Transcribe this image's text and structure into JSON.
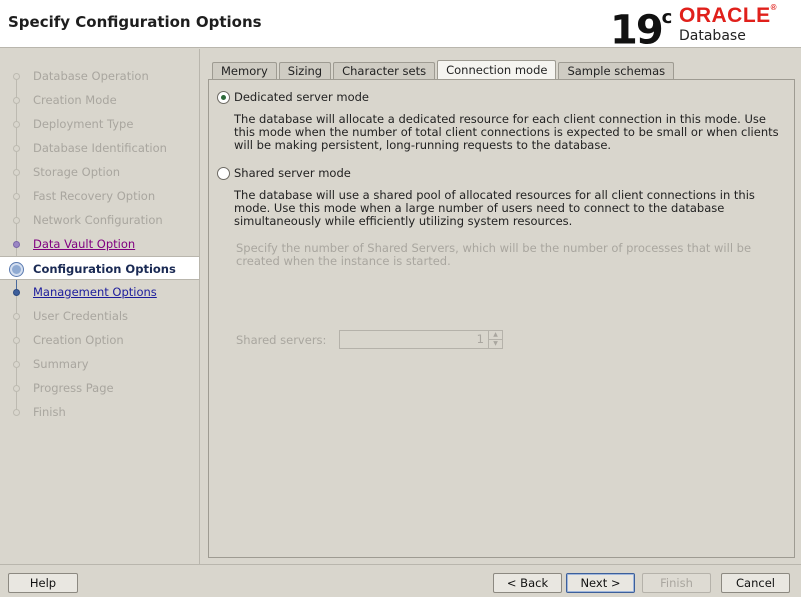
{
  "header": {
    "title": "Specify Configuration Options",
    "logo": {
      "version": "19",
      "version_sup": "c",
      "brand": "ORACLE",
      "brand_mark": "®",
      "product": "Database"
    }
  },
  "sidebar": {
    "steps": [
      {
        "label": "Database Operation",
        "state": "disabled"
      },
      {
        "label": "Creation Mode",
        "state": "disabled"
      },
      {
        "label": "Deployment Type",
        "state": "disabled"
      },
      {
        "label": "Database Identification",
        "state": "disabled"
      },
      {
        "label": "Storage Option",
        "state": "disabled"
      },
      {
        "label": "Fast Recovery Option",
        "state": "disabled"
      },
      {
        "label": "Network Configuration",
        "state": "disabled"
      },
      {
        "label": "Data Vault Option",
        "state": "visited"
      },
      {
        "label": "Configuration Options",
        "state": "current"
      },
      {
        "label": "Management Options",
        "state": "link"
      },
      {
        "label": "User Credentials",
        "state": "disabled"
      },
      {
        "label": "Creation Option",
        "state": "disabled"
      },
      {
        "label": "Summary",
        "state": "disabled"
      },
      {
        "label": "Progress Page",
        "state": "disabled"
      },
      {
        "label": "Finish",
        "state": "disabled"
      }
    ]
  },
  "tabs": [
    {
      "label": "Memory",
      "active": false
    },
    {
      "label": "Sizing",
      "active": false
    },
    {
      "label": "Character sets",
      "active": false
    },
    {
      "label": "Connection mode",
      "active": true
    },
    {
      "label": "Sample schemas",
      "active": false
    }
  ],
  "connection_mode": {
    "dedicated": {
      "label": "Dedicated server mode",
      "selected": true,
      "description": "The database will allocate a dedicated resource for each client connection in this mode. Use this mode when the number of total client connections is expected to be small or when clients will be making persistent, long-running requests to the database."
    },
    "shared": {
      "label": "Shared server mode",
      "selected": false,
      "description": "The database will use a shared pool of allocated resources for all client connections in this mode.  Use this mode when a large number of users need to connect to the database simultaneously while efficiently utilizing system resources.",
      "servers_hint": "Specify the number of Shared Servers, which will be the number of processes that will be created when the instance is started.",
      "servers_label": "Shared servers:",
      "servers_value": "1"
    }
  },
  "footer": {
    "help": "Help",
    "back": "< Back",
    "next": "Next >",
    "finish": "Finish",
    "cancel": "Cancel"
  }
}
